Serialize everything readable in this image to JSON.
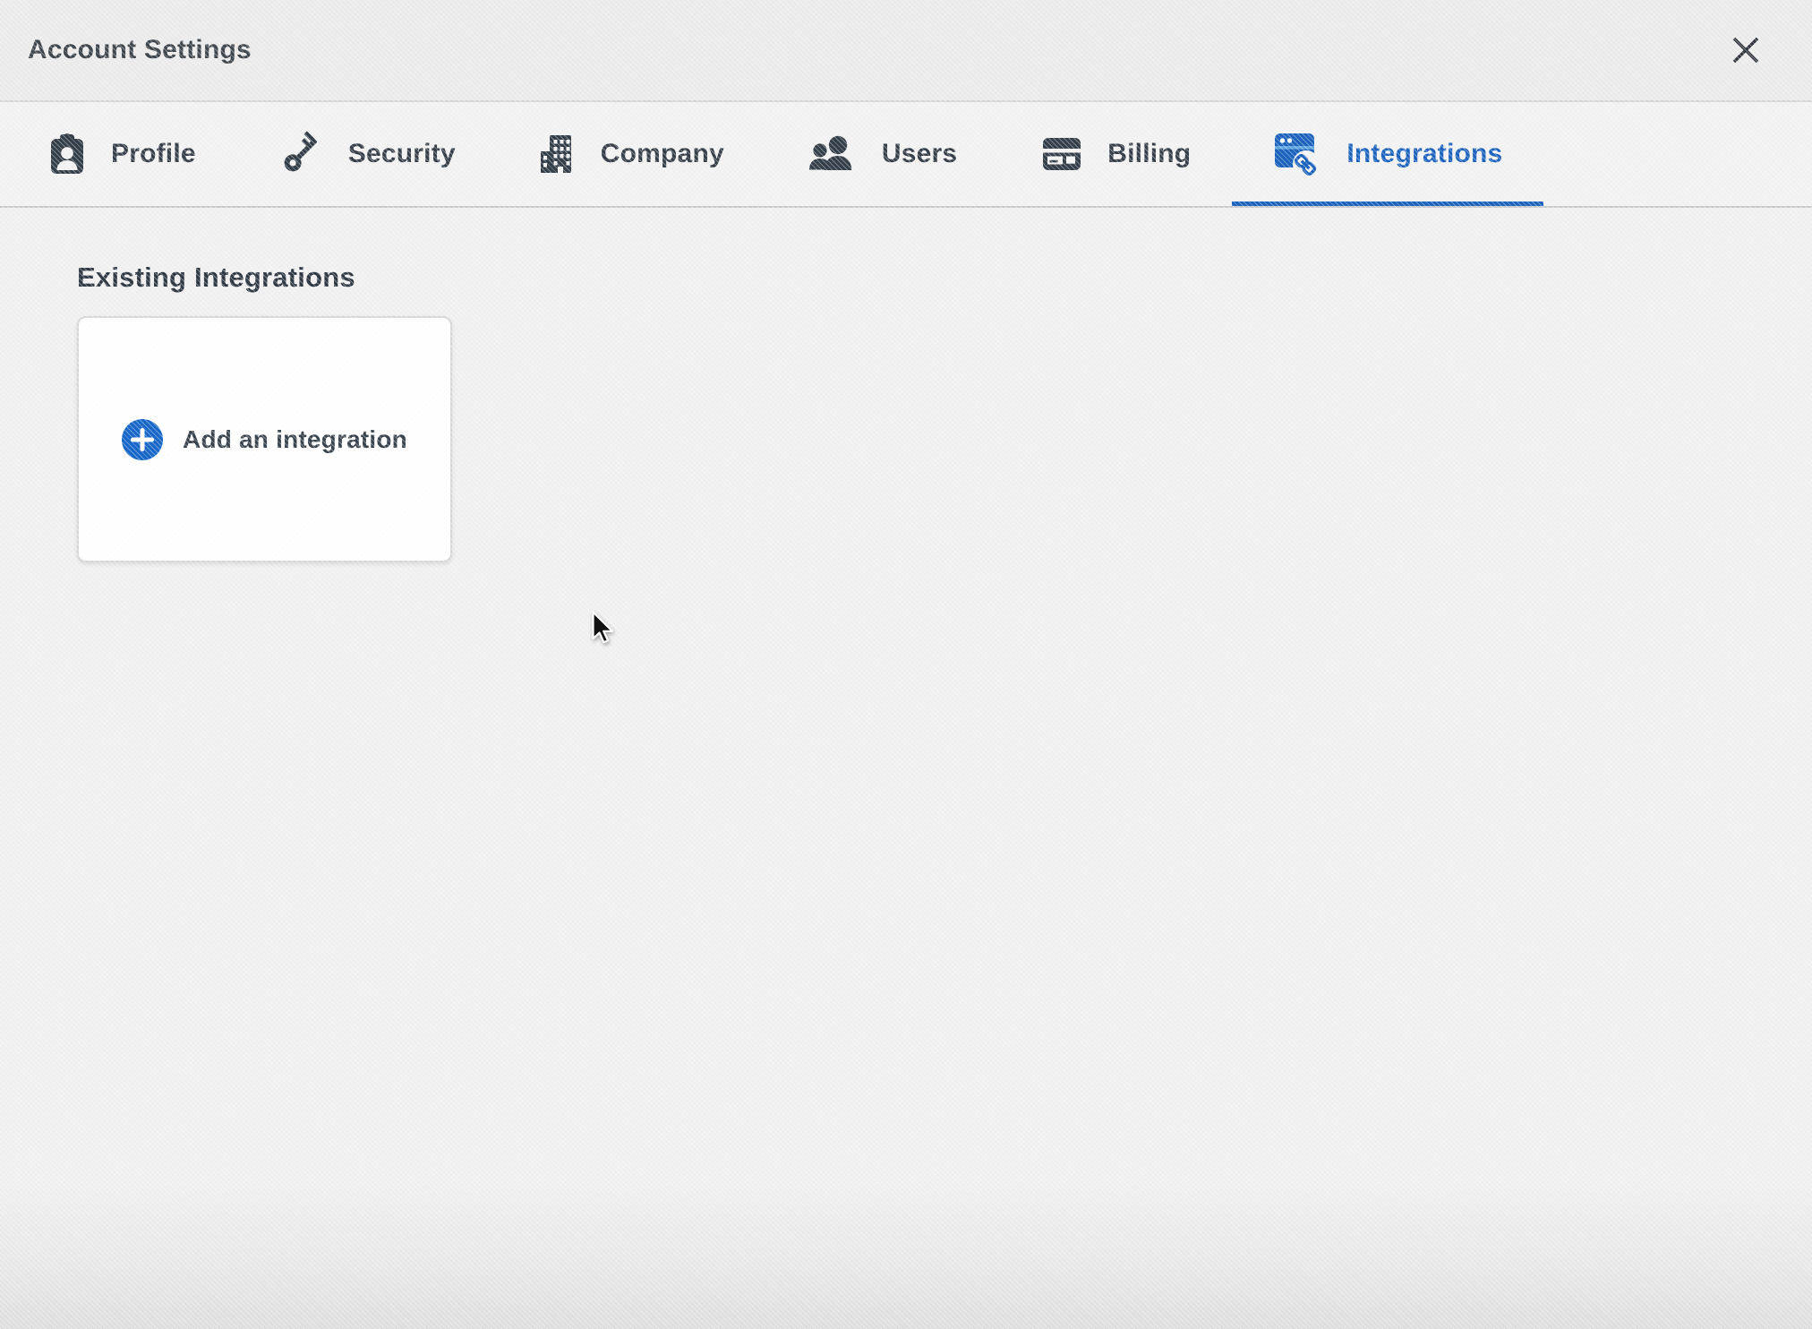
{
  "window": {
    "title": "Account Settings",
    "close_button": {
      "icon": "close-x-icon",
      "label": "Close"
    }
  },
  "tabs": [
    {
      "label": "Profile",
      "icon": "id-badge-icon",
      "active": false
    },
    {
      "label": "Security",
      "icon": "key-icon",
      "active": false
    },
    {
      "label": "Company",
      "icon": "building-icon",
      "active": false
    },
    {
      "label": "Users",
      "icon": "users-icon",
      "active": false
    },
    {
      "label": "Billing",
      "icon": "credit-card-icon",
      "active": false
    },
    {
      "label": "Integrations",
      "icon": "window-link-icon",
      "active": true
    }
  ],
  "content": {
    "section_heading": "Existing Integrations",
    "add_card": {
      "label": "Add an integration",
      "icon": "plus-circle-icon"
    }
  },
  "cursor": {
    "style": "left:661px;top:682px"
  },
  "colors": {
    "accent_blue": "#1b63bd",
    "plus_circle_blue": "#1767c8",
    "icon_slate": "#333e49",
    "tab_label": "#363f49",
    "heading_text": "#2f3944",
    "header_bg": "#ebebec",
    "tab_bar_bg": "#f2f2f3",
    "content_bg": "#f0f0f1",
    "card_border": "#d5d7d9",
    "tab_bar_border": "#c7c9cb"
  }
}
